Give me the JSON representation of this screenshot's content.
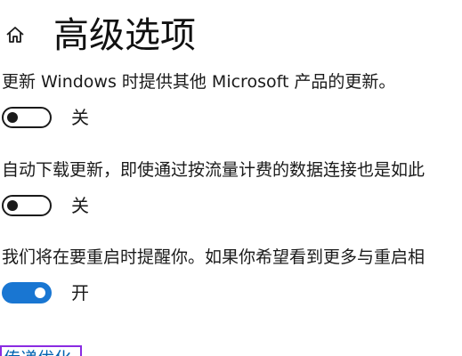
{
  "header": {
    "home_icon": "home-icon",
    "title": "高级选项"
  },
  "settings": [
    {
      "text": "更新 Windows 时提供其他 Microsoft 产品的更新。",
      "toggle": {
        "state": "off",
        "label": "关"
      }
    },
    {
      "text": "自动下载更新，即使通过按流量计费的数据连接也是如此",
      "toggle": {
        "state": "off",
        "label": "关"
      }
    },
    {
      "text": "我们将在要重启时提醒你。如果你希望看到更多与重启相",
      "toggle": {
        "state": "on",
        "label": "开"
      }
    }
  ],
  "bottom_link": {
    "label": "传递优化"
  },
  "colors": {
    "toggle_on": "#1976d2",
    "link": "#0063b1",
    "focus_outline": "#8a2be2"
  }
}
